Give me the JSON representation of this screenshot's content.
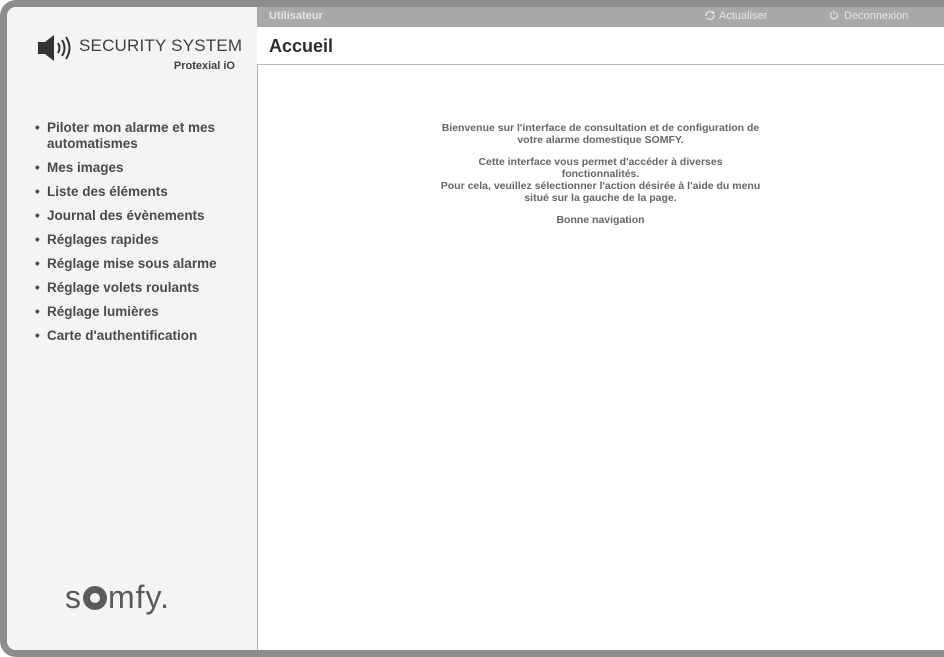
{
  "logo": {
    "title": "SECURITY SYSTEM",
    "subtitle": "Protexial iO",
    "icon": "speaker-icon"
  },
  "topbar": {
    "user_label": "Utilisateur",
    "refresh_label": "Actualiser",
    "refresh_icon": "refresh-icon",
    "logout_label": "Deconnexion",
    "logout_icon": "logout-icon"
  },
  "page": {
    "title": "Accueil"
  },
  "menu": {
    "bullet": "•",
    "items": [
      {
        "label": "Piloter mon alarme et mes automatismes"
      },
      {
        "label": "Mes images"
      },
      {
        "label": "Liste des éléments"
      },
      {
        "label": "Journal des évènements"
      },
      {
        "label": "Réglages rapides"
      },
      {
        "label": "Réglage mise sous alarme"
      },
      {
        "label": "Réglage volets roulants"
      },
      {
        "label": "Réglage lumières"
      },
      {
        "label": "Carte d'authentification"
      }
    ]
  },
  "welcome": {
    "line1": "Bienvenue sur l'interface de consultation et de configuration de",
    "line2": "votre alarme domestique SOMFY.",
    "line3": "Cette interface vous permet d'accéder à diverses",
    "line4": "fonctionnalités.",
    "line5": "Pour cela, veuillez sélectionner l'action désirée à l'aide du menu",
    "line6": "situé sur la gauche de la page.",
    "line7": "Bonne navigation"
  },
  "footer": {
    "brand_s": "s",
    "brand_rest": "mfy."
  },
  "colors": {
    "frame": "#8d8d8d",
    "sidebar_bg": "#f4f4f4",
    "topbar_bg": "#a9a9a9",
    "menu_text": "#4a4a4a",
    "content_text": "#666666"
  }
}
